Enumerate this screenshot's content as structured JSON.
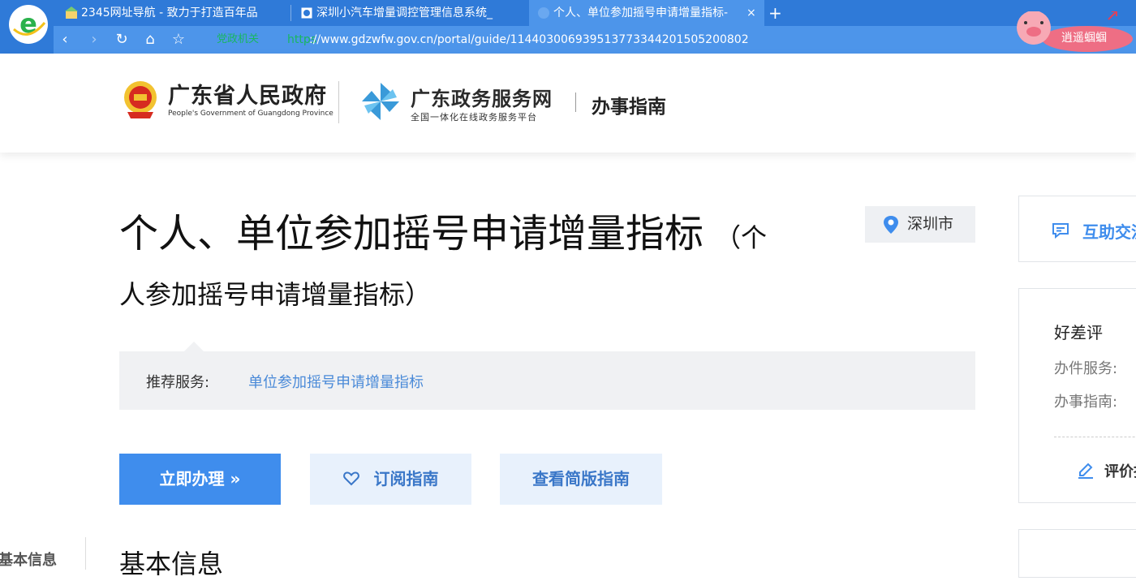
{
  "browser": {
    "tabs": [
      {
        "title": "2345网址导航 - 致力于打造百年品",
        "active": false
      },
      {
        "title": "深圳小汽车增量调控管理信息系统_",
        "active": false
      },
      {
        "title": "个人、单位参加摇号申请增量指标-",
        "active": true
      }
    ],
    "close_glyph": "×",
    "new_tab_glyph": "+",
    "nav": {
      "back": "‹",
      "forward": "›",
      "reload": "↻",
      "home": "⌂",
      "favorite": "☆"
    },
    "address": {
      "badge": "党政机关",
      "scheme": "https",
      "url": "://www.gdzwfw.gov.cn/portal/guide/11440300693951377334420150520080​2"
    },
    "mascot_label": "逍遥蝈蝈"
  },
  "site_header": {
    "gov_name": "广东省人民政府",
    "gov_name_en": "People's Government of Guangdong Province",
    "portal_name": "广东政务服务网",
    "portal_sub": "全国一体化在线政务服务平台",
    "section": "办事指南"
  },
  "main": {
    "title": "个人、单位参加摇号申请增量指标",
    "title_paren_start": "（个",
    "title_line2": "人参加摇号申请增量指标）",
    "city": "深圳市",
    "recommended_label": "推荐服务:",
    "recommended_link": "单位参加摇号申请增量指标",
    "buttons": {
      "apply": "立即办理 »",
      "subscribe": "订阅指南",
      "simple": "查看简版指南"
    },
    "side_nav_basic": "基本信息",
    "section_heading": "基本信息"
  },
  "right": {
    "interaction": "互助交流",
    "rating_title": "好差评",
    "rating_service": "办件服务:",
    "rating_guide": "办事指南:",
    "evaluate": "评价指南"
  },
  "colors": {
    "browser_blue": "#2f7ad8",
    "primary": "#3f8ded",
    "link": "#4a8ad8",
    "light_button": "#e8f1fc"
  }
}
